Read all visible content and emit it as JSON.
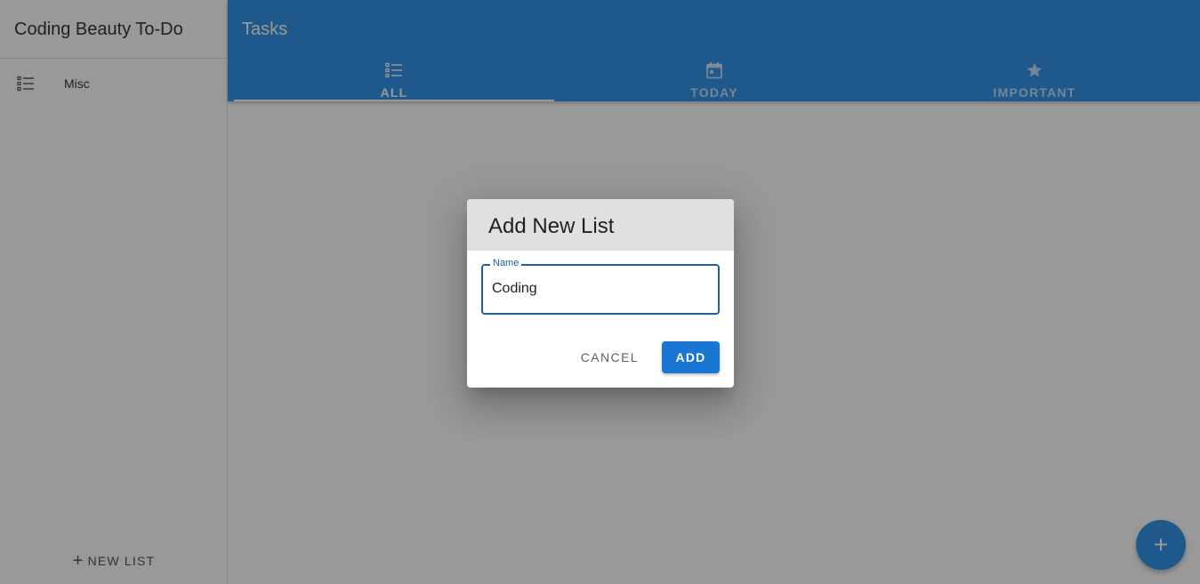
{
  "sidebar": {
    "title": "Coding Beauty To-Do",
    "items": [
      {
        "label": "Misc",
        "icon": "list-icon"
      }
    ],
    "new_list_label": "NEW LIST",
    "new_list_icon": "plus-icon"
  },
  "appbar": {
    "title": "Tasks",
    "tabs": [
      {
        "label": "ALL",
        "icon": "format-list-icon",
        "active": true
      },
      {
        "label": "TODAY",
        "icon": "calendar-today-icon",
        "active": false
      },
      {
        "label": "IMPORTANT",
        "icon": "star-icon",
        "active": false
      }
    ]
  },
  "fab": {
    "icon": "plus-icon",
    "label": "+"
  },
  "dialog": {
    "title": "Add New List",
    "field_label": "Name",
    "field_value": "Coding",
    "cancel_label": "CANCEL",
    "add_label": "ADD"
  },
  "colors": {
    "primary": "#1e88e5",
    "button": "#1976d2",
    "overlay": "rgba(33,33,33,0.46)"
  }
}
